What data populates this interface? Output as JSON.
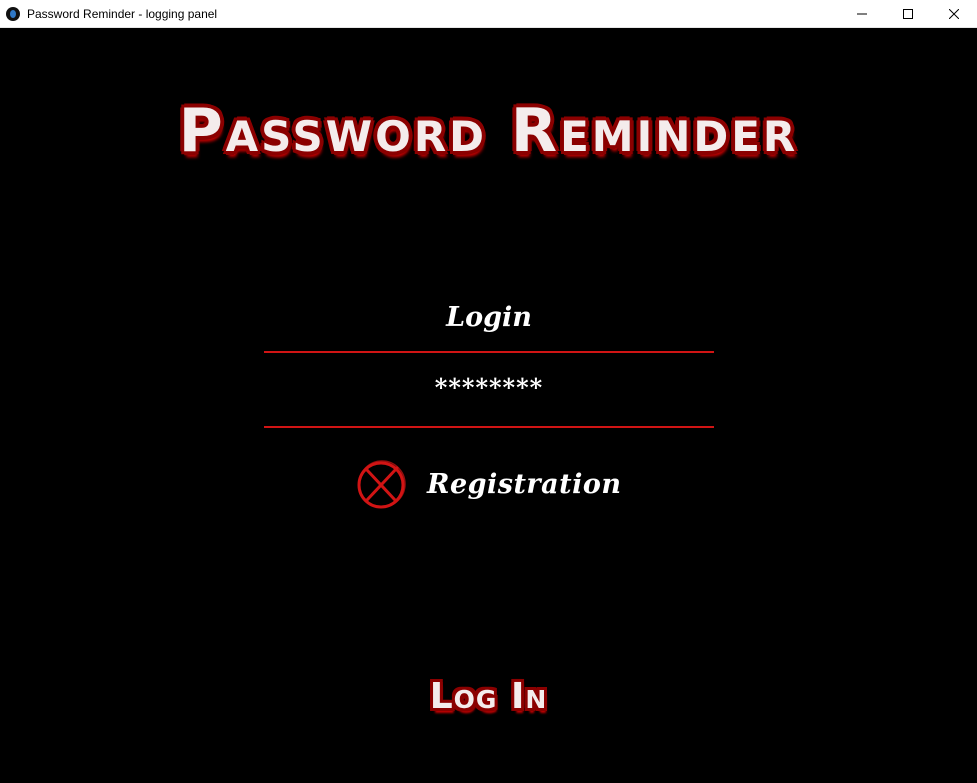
{
  "window": {
    "title": "Password Reminder - logging panel",
    "icon": "app-icon",
    "controls": [
      "minimize-icon",
      "maximize-icon",
      "close-icon"
    ]
  },
  "panel": {
    "app_title": "Password Reminder",
    "login_value": "Login",
    "password_value": "********",
    "registration_label": "Registration",
    "registration_icon": "x-circle-icon",
    "login_button_label": "Log In"
  },
  "colors": {
    "background": "#000000",
    "accent_red": "#d11414",
    "title_outline": "#8b0000",
    "text": "#ffffff"
  }
}
